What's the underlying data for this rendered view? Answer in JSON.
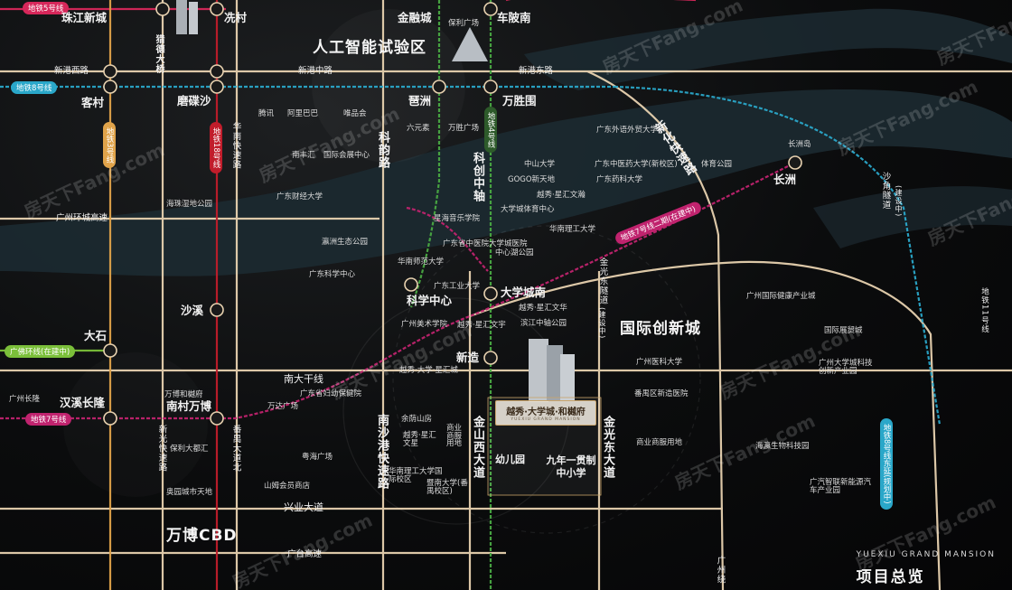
{
  "metro_lines": {
    "line5": "地铁5号线",
    "line8": "地铁8号线",
    "line3": "地铁3号线",
    "line18": "地铁18号线",
    "line4": "地铁4号线",
    "line7": "地铁7号线",
    "guangfo": "广佛环线(在建中)",
    "line7_phase2": "地铁7号线二期(在建中)",
    "line8_east": "地铁8号线东延(规划中)",
    "line11": "地铁11号线"
  },
  "stations": {
    "zhujiang_newtown": "珠江新城",
    "liede": "猎德大桥",
    "xiancun": "冼村",
    "jinrongcheng": "金融城",
    "chebeinan": "车陂南",
    "kecun": "客村",
    "mocasha": "磨碟沙",
    "pazhou": "琶洲",
    "wanshengwei": "万胜围",
    "changzhou": "长洲",
    "shaxi": "沙溪",
    "dashi": "大石",
    "kexuezhongxin": "科学中心",
    "daxuechengnan": "大学城南",
    "xinzao": "新造",
    "hanxichanglong": "汉溪长隆",
    "nancunwanbo": "南村万博"
  },
  "areas": {
    "ai_zone": "人工智能试验区",
    "intl_innovation": "国际创新城",
    "wanbo_cbd": "万博CBD"
  },
  "roads": {
    "xingangxi": "新港西路",
    "xingangzhong": "新港中路",
    "xingangdong": "新港东路",
    "huanchengexpress": "广州环城高速",
    "nandaganxian": "南大干线",
    "xingyedadao": "兴业大道",
    "guangtai": "广台高速",
    "kecuo": "科韵路",
    "kechuang_axis": "科创中轴",
    "huanan": "华南快速路",
    "xinhua": "新化快速路",
    "jinguangdongsui": "金光东隧道",
    "jinguangdongsui_sub": "(建设中)",
    "nanshagang": "南沙港快速路",
    "jinshanxi": "金山西大道",
    "jinguangdong": "金光东大道",
    "panyudadao": "番禺大道北",
    "xinguang": "新光快速路",
    "shadao": "沙角隧道",
    "shadao_sub": "(建设中)",
    "guangzhouring": "广州绕"
  },
  "pois": [
    "保利广场",
    "腾讯",
    "阿里巴巴",
    "唯品会",
    "六元素",
    "南丰汇",
    "国际会展中心",
    "万胜广场",
    "广东外语外贸大学",
    "中山大学",
    "广东中医药大学(新校区)",
    "体育公园",
    "长洲岛",
    "广东财经大学",
    "GOGO新天地",
    "广东药科大学",
    "越秀·星汇文瀚",
    "大学城体育中心",
    "海珠湿地公园",
    "星海音乐学院",
    "华南理工大学",
    "广东省中医院大学城医院",
    "瀛洲生态公园",
    "中心湖公园",
    "华南师范大学",
    "广东科学中心",
    "广东工业大学",
    "越秀·星汇文华",
    "广州国际健康产业城",
    "广州美术学院",
    "越秀·星汇文宇",
    "滨江中轴公园",
    "国际展贸城",
    "越秀·大学·星汇城",
    "广州医科大学",
    "广州大学城科技创新产业园",
    "广州长隆",
    "万博和樾府",
    "广东省妇幼保健院",
    "番禺区新造医院",
    "万达广场",
    "余荫山房",
    "越秀·星汇文星",
    "商业商服用地",
    "保利大都汇",
    "商业商服用地",
    "海瀛生物科技园",
    "粤海广场",
    "华南理工大学国际校区",
    "暨南大学(番禺校区)",
    "广汽智联新能源汽车产业园",
    "奥园城市天地",
    "山姆会员商店"
  ],
  "project": {
    "name": "越秀·大学城·和樾府",
    "name_en": "YUEXIU GRAND MANSION",
    "kindergarten": "幼儿园",
    "school": "九年一贯制中小学",
    "footer_en": "YUEXIU GRAND MANSION",
    "footer_cn": "项目总览"
  },
  "watermark": "房天下Fang.com",
  "colors": {
    "line5": "#d6275a",
    "line8": "#2aa7c9",
    "line3": "#e0a34a",
    "line18": "#c11d2b",
    "line4": "#49a943",
    "line7": "#c0236e",
    "line11": "#7bbf3a",
    "road": "#e8d2b0",
    "river": "#1e2c33",
    "gold": "#c9a46a"
  }
}
